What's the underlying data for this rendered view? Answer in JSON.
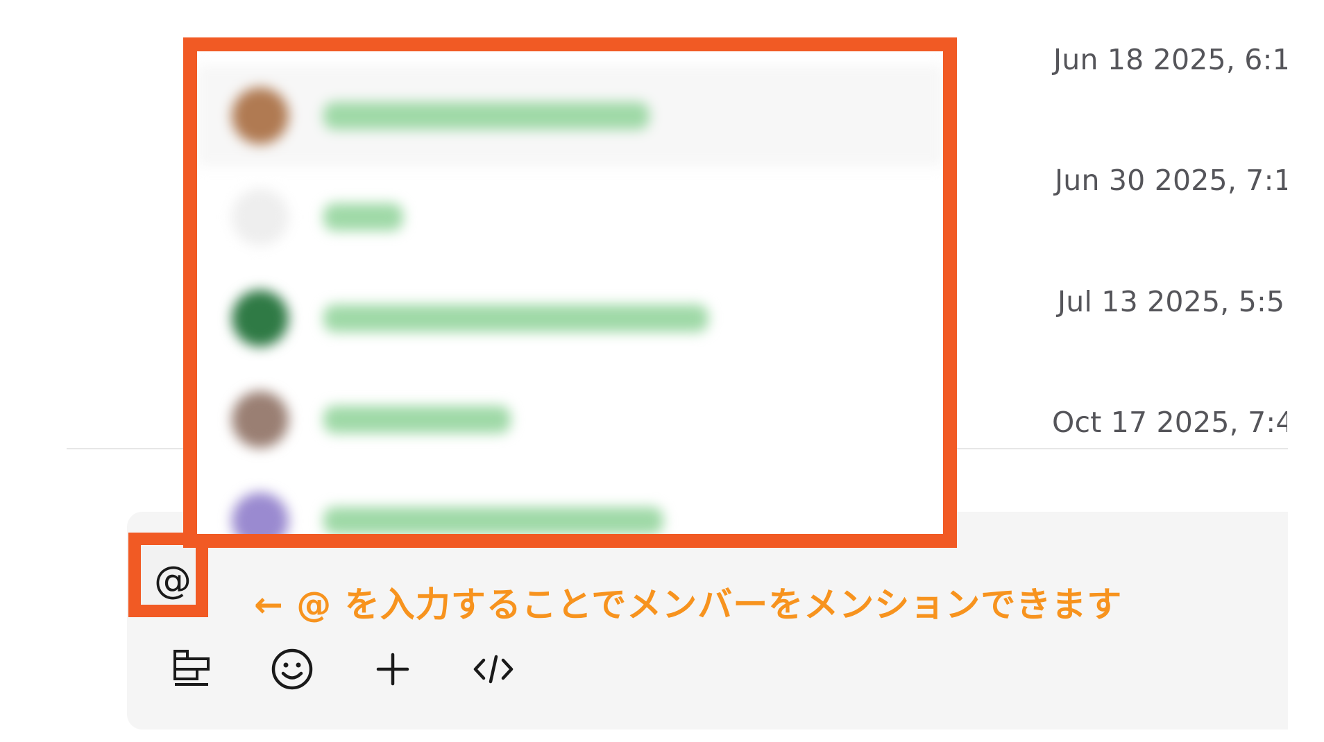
{
  "messages": {
    "timestamps": [
      "Jun 18 2025, 6:1",
      "Jun 30 2025, 7:1",
      "Jul 13 2025, 5:5",
      "Oct 17 2025, 7:4"
    ]
  },
  "mention_popup": {
    "members": [
      {
        "avatar_color": "#b07a52",
        "name": "",
        "active": true
      },
      {
        "avatar_color": "#eeeeee",
        "name": "",
        "active": false
      },
      {
        "avatar_color": "#2f7a45",
        "name": "",
        "active": false
      },
      {
        "avatar_color": "#9a7f73",
        "name": "",
        "active": false
      },
      {
        "avatar_color": "#9a8ad0",
        "name": "",
        "active": false
      }
    ]
  },
  "composer": {
    "mention_symbol": "@",
    "toolbar": {
      "icons": [
        "text-format-icon",
        "emoji-icon",
        "plus-icon",
        "code-icon"
      ]
    }
  },
  "annotation": {
    "text": "← @ を入力することでメンバーをメンションできます"
  },
  "colors": {
    "highlight": "#f15a24",
    "annotation_text": "#f7931e",
    "composer_bg": "#f5f5f5",
    "timestamp_text": "#55555a",
    "name_placeholder": "#9fd9a7"
  }
}
